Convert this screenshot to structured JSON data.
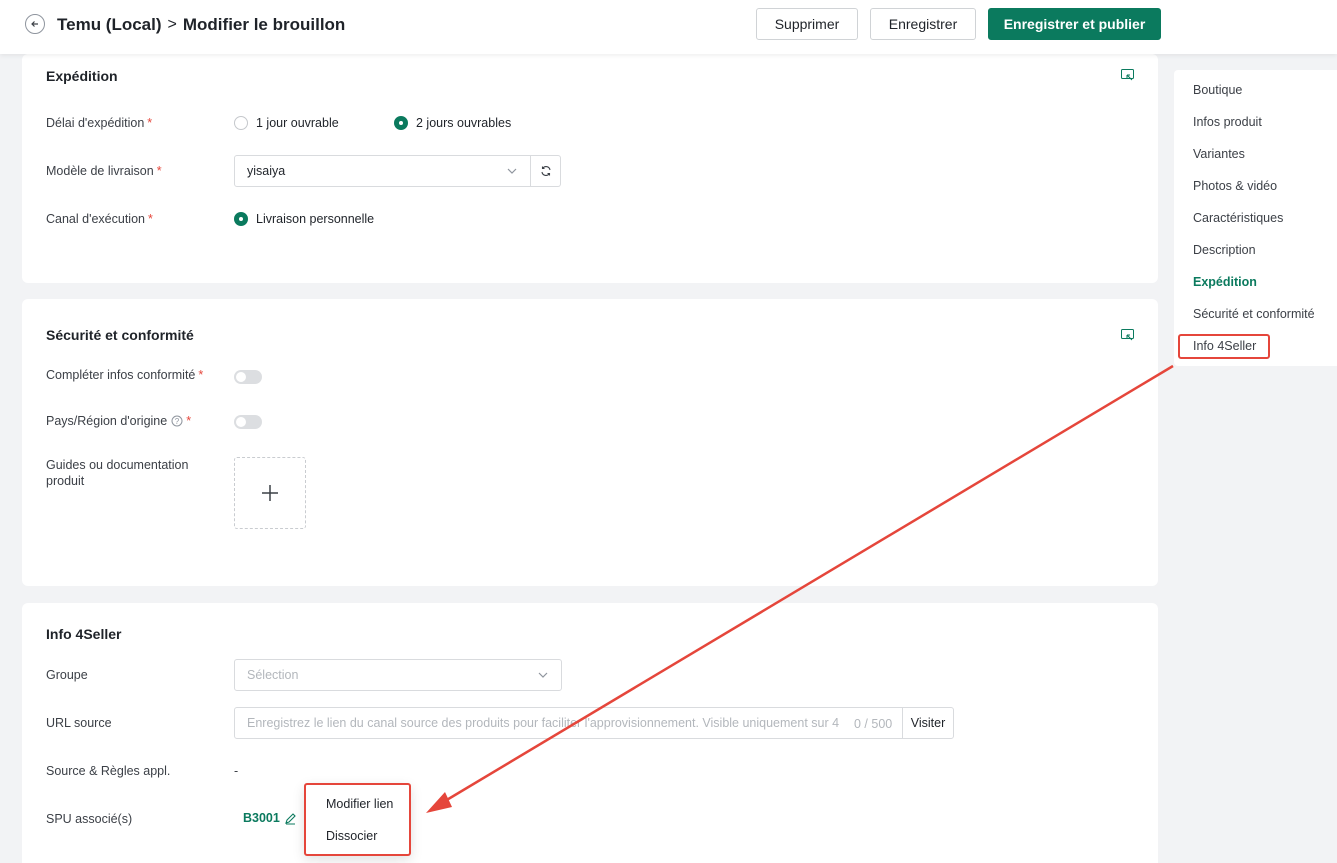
{
  "header": {
    "breadcrumb_root": "Temu (Local)",
    "breadcrumb_separator": ">",
    "breadcrumb_current": "Modifier le brouillon",
    "delete_label": "Supprimer",
    "save_label": "Enregistrer",
    "publish_label": "Enregistrer et publier"
  },
  "shipping": {
    "title": "Expédition",
    "delay_label": "Délai d'expédition",
    "delay_options": [
      "1 jour ouvrable",
      "2 jours ouvrables"
    ],
    "delay_selected": "2 jours ouvrables",
    "template_label": "Modèle de livraison",
    "template_value": "yisaiya",
    "channel_label": "Canal d'exécution",
    "channel_value": "Livraison personnelle",
    "required_mark": "*"
  },
  "compliance": {
    "title": "Sécurité et conformité",
    "complete_label": "Compléter infos conformité",
    "complete_on": false,
    "origin_label": "Pays/Région d'origine",
    "origin_on": false,
    "guides_label_line1": "Guides ou documentation",
    "guides_label_line2": "produit"
  },
  "info4seller": {
    "title": "Info 4Seller",
    "group_label": "Groupe",
    "group_placeholder": "Sélection",
    "url_label": "URL source",
    "url_placeholder": "Enregistrez le lien du canal source des produits pour faciliter l'approvisionnement. Visible uniquement sur 4",
    "url_counter": "0 / 500",
    "visit_label": "Visiter",
    "rules_label": "Source & Règles appl.",
    "rules_value": "-",
    "spu_label": "SPU associé(s)",
    "spu_value": "B3001"
  },
  "spu_menu": {
    "items": [
      "Modifier lien",
      "Dissocier"
    ]
  },
  "side_nav": {
    "items": [
      "Boutique",
      "Infos produit",
      "Variantes",
      "Photos & vidéo",
      "Caractéristiques",
      "Description",
      "Expédition",
      "Sécurité et conformité",
      "Info 4Seller"
    ],
    "active": "Expédition",
    "highlighted": "Info 4Seller"
  },
  "colors": {
    "brand": "#0b7a5e",
    "annotation": "#e5463b"
  }
}
